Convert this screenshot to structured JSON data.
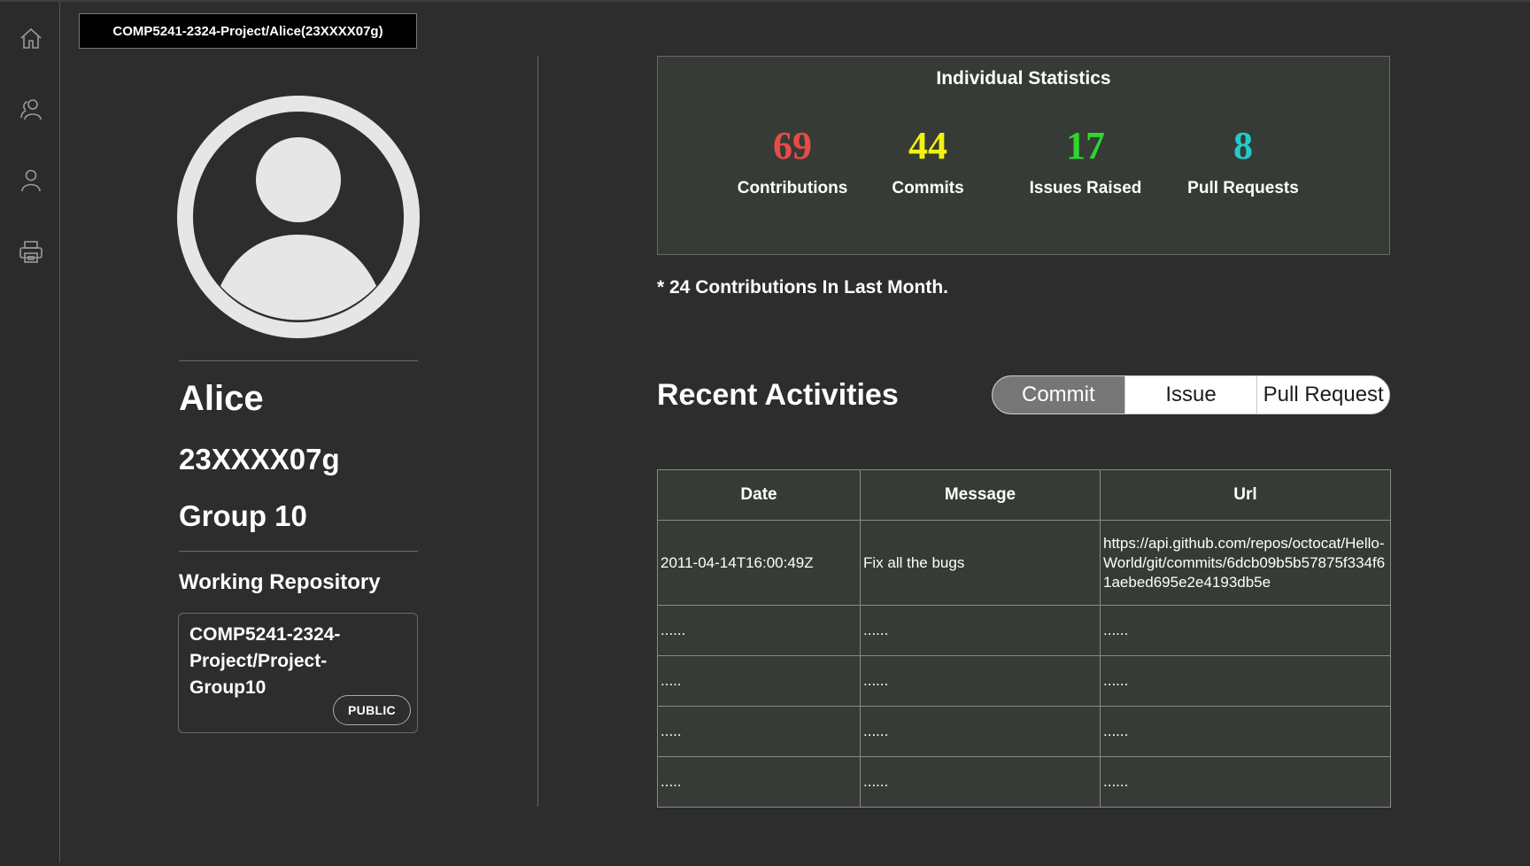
{
  "breadcrumb": "COMP5241-2324-Project/Alice(23XXXX07g)",
  "nav": [
    {
      "name": "home",
      "icon": "home-icon"
    },
    {
      "name": "group",
      "icon": "users-icon"
    },
    {
      "name": "profile",
      "icon": "user-icon"
    },
    {
      "name": "print",
      "icon": "printer-icon"
    }
  ],
  "profile": {
    "name": "Alice",
    "student_id": "23XXXX07g",
    "group": "Group 10",
    "repo_heading": "Working Repository",
    "repo_name": "COMP5241-2324-Project/Project-Group10",
    "repo_visibility": "PUBLIC"
  },
  "stats": {
    "title": "Individual Statistics",
    "items": [
      {
        "value": "69",
        "label": "Contributions",
        "color": "#e84a4a"
      },
      {
        "value": "44",
        "label": "Commits",
        "color": "#f2f20f"
      },
      {
        "value": "17",
        "label": "Issues Raised",
        "color": "#2fd62f"
      },
      {
        "value": "8",
        "label": "Pull Requests",
        "color": "#22cbcb"
      }
    ],
    "note": "* 24 Contributions In Last Month."
  },
  "activities": {
    "title": "Recent Activities",
    "tabs": [
      "Commit",
      "Issue",
      "Pull Request"
    ],
    "active_tab": "Commit",
    "columns": [
      "Date",
      "Message",
      "Url"
    ],
    "rows": [
      [
        "2011-04-14T16:00:49Z",
        "Fix all the bugs",
        "https://api.github.com/repos/octocat/Hello-World/git/commits/6dcb09b5b57875f334f61aebed695e2e4193db5e"
      ],
      [
        "......",
        "......",
        "......"
      ],
      [
        ".....",
        "......",
        "......"
      ],
      [
        ".....",
        "......",
        "......"
      ],
      [
        ".....",
        "......",
        "......"
      ]
    ]
  }
}
